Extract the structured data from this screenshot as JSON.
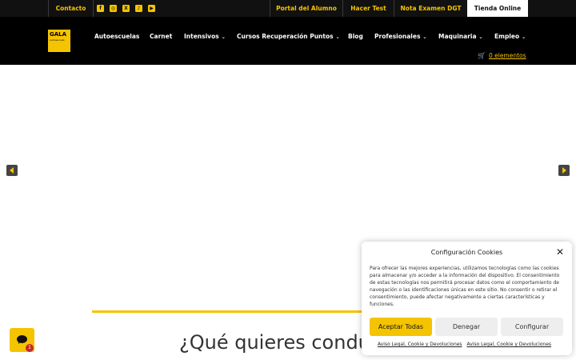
{
  "topbar": {
    "contact_label": "Contacto",
    "social_icons": [
      "facebook-icon",
      "instagram-icon",
      "x-icon",
      "tiktok-icon",
      "youtube-icon"
    ],
    "portal_label": "Portal del Alumno",
    "test_label": "Hacer Test",
    "nota_label": "Nota Examen DGT",
    "tienda_label": "Tienda Online"
  },
  "logo": {
    "line1": "GALA",
    "line2": "Autoescuela"
  },
  "nav": {
    "autoescuelas": "Autoescuelas",
    "carnet": "Carnet",
    "intensivos": "Intensivos",
    "cursos": "Cursos Recuperación Puntos",
    "blog": "Blog",
    "profesionales": "Profesionales",
    "maquinaria": "Maquinaria",
    "empleo": "Empleo"
  },
  "cart": {
    "label": "0 elementos",
    "icon": "cart-icon"
  },
  "hero": {
    "heading": "¿Qué quieres condu"
  },
  "chat": {
    "badge": "1",
    "icon": "chat-bubble-icon"
  },
  "cookie": {
    "title": "Configuración Cookies",
    "body": "Para ofrecer las mejores experiencias, utilizamos tecnologías como las cookies para almacenar y/o acceder a la información del dispositivo. El consentimiento de estas tecnologías nos permitirá procesar datos como el comportamiento de navegación o las identificaciones únicas en este sitio. No consentir o retirar el consentimiento, puede afectar negativamente a ciertas características y funciones.",
    "accept_label": "Aceptar Todas",
    "deny_label": "Denegar",
    "config_label": "Configurar",
    "link1": "Aviso Legal, Cookie y Devoluciones",
    "link2": "Aviso Legal, Cookie y Devoluciones"
  },
  "colors": {
    "accent": "#f5c400",
    "header_bg": "#000000",
    "topbar_bg": "#111111"
  }
}
